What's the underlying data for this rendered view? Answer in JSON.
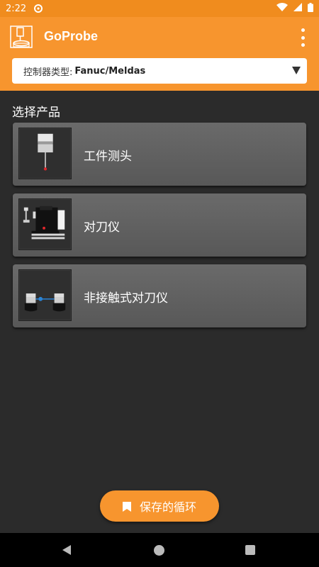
{
  "status_bar": {
    "time": "2:22"
  },
  "app_bar": {
    "title": "GoProbe"
  },
  "controller": {
    "label": "控制器类型:",
    "value": "Fanuc/Meldas"
  },
  "section": {
    "title": "选择产品"
  },
  "products": [
    {
      "label": "工件测头",
      "icon": "spindle-probe-icon"
    },
    {
      "label": "对刀仪",
      "icon": "tool-setter-icon"
    },
    {
      "label": "非接触式对刀仪",
      "icon": "laser-tool-setter-icon"
    }
  ],
  "saved_button": {
    "label": "保存的循环",
    "icon": "bookmark-icon"
  },
  "colors": {
    "accent": "#f7952e",
    "background": "#2b2b2b",
    "card": "#616161"
  }
}
